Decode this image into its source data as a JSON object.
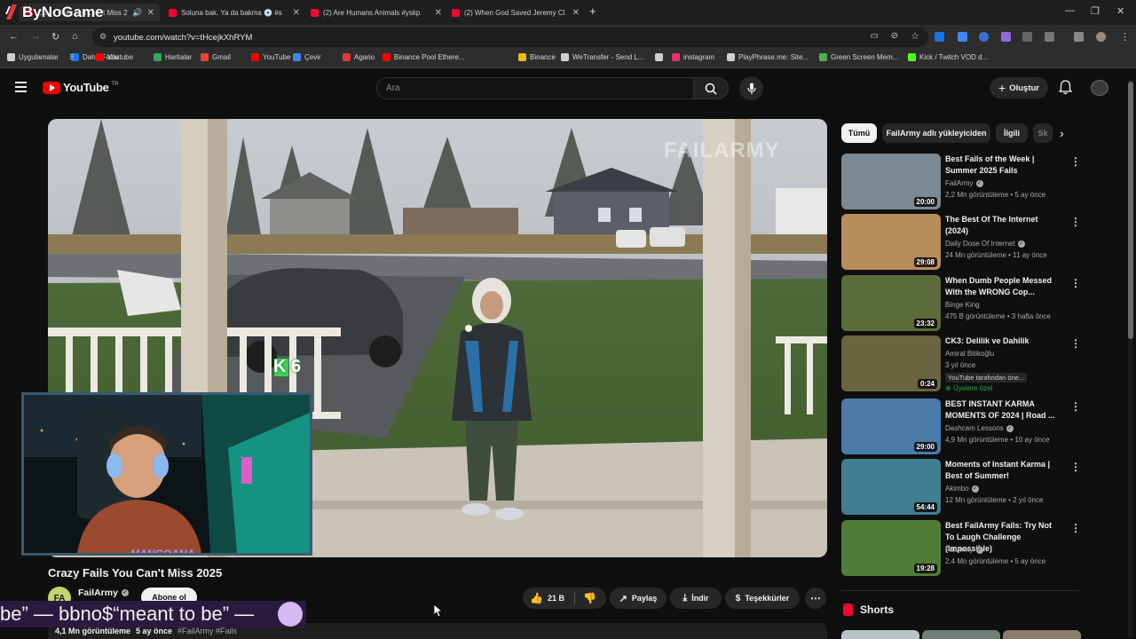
{
  "browser": {
    "tabs": [
      {
        "title": "Crazy Fails You Can't Miss 2025",
        "active": true
      },
      {
        "title": "Soluna bak. Ya da bakma 💿 #s"
      },
      {
        "title": "(2) Are Humans Animals #yskp"
      },
      {
        "title": "(2) When God Saved Jeremy Cl"
      }
    ],
    "new_tab": "+",
    "url": "youtube.com/watch?v=tHcejkXhRYM",
    "bookmarks": [
      {
        "label": "Uygulamalar",
        "color": "#d0d0d0"
      },
      {
        "label": "Daha Fazla",
        "color": "#1877f2"
      },
      {
        "label": "Youtube",
        "color": "#ff0000"
      },
      {
        "label": "Haritalar",
        "color": "#34a853"
      },
      {
        "label": "Gmail",
        "color": "#ea4335"
      },
      {
        "label": "YouTube",
        "color": "#ff0000"
      },
      {
        "label": "Çevir",
        "color": "#4285f4"
      },
      {
        "label": "Agario",
        "color": "#e53935"
      },
      {
        "label": "Binance Pool Ethere...",
        "color": "#ff0000"
      },
      {
        "label": "Binance",
        "color": "#f0b90b"
      },
      {
        "label": "WeTransfer - Send L...",
        "color": "#cfcfcf"
      },
      {
        "label": "",
        "color": "#cfcfcf"
      },
      {
        "label": "instagram",
        "color": "#e1306c"
      },
      {
        "label": "PlayPhrase.me: Site...",
        "color": "#cfcfcf"
      },
      {
        "label": "Green Screen Mem...",
        "color": "#4caf50"
      },
      {
        "label": "Kick / Twitch VOD d...",
        "color": "#53fc18"
      }
    ]
  },
  "overlay": {
    "stream_logo": "ByNoGame",
    "cam_label": "MANGOANA",
    "lyrics": "be” — bbno$“meant to be” —",
    "video_overlay_text": "K 6",
    "watermark": "FAILARMY"
  },
  "youtube": {
    "logo": "YouTube",
    "country": "TR",
    "search_placeholder": "Ara",
    "create_label": "Oluştur",
    "video": {
      "title": "Crazy Fails You Can't Miss 2025",
      "channel": "FailArmy",
      "channel_initials": "FA",
      "subscribe_label": "Abone ol",
      "likes": "21 B",
      "share_label": "Paylaş",
      "download_label": "İndir",
      "thanks_label": "Teşekkürler",
      "views": "4,1 Mn görüntüleme",
      "age": "5 ay önce",
      "hashtags": "#FailArmy #Fails"
    },
    "chips": [
      "Tümü",
      "FailArmy adlı yükleyiciden",
      "İlgili",
      "Sk"
    ],
    "recommendations": [
      {
        "title": "Best Fails of the Week | Summer 2025 Fails",
        "channel": "FailArmy",
        "verified": true,
        "meta": "2,2 Mn görüntüleme • 5 ay önce",
        "duration": "20:00",
        "thumb": "#7c8a95"
      },
      {
        "title": "The Best Of The Internet (2024)",
        "channel": "Daily Dose Of Internet",
        "verified": true,
        "meta": "24 Mn görüntüleme • 11 ay önce",
        "duration": "29:08",
        "thumb": "#b98d5a"
      },
      {
        "title": "When Dumb People Messed With the WRONG Cop...",
        "channel": "Binge King",
        "verified": false,
        "meta": "475 B görüntüleme • 3 hafta önce",
        "duration": "23:32",
        "thumb": "#5c6b3a"
      },
      {
        "title": "CK3: Delilik ve Dahilik",
        "channel": "Amiral Bitikoğlu",
        "verified": false,
        "meta": "3 yıl önce",
        "duration": "0:24",
        "thumb": "#6b6440",
        "tag": "YouTube tarafından öne...",
        "members": "Üyelere özel"
      },
      {
        "title": "BEST INSTANT KARMA MOMENTS OF 2024 | Road ...",
        "channel": "Dashcam Lessons",
        "verified": true,
        "meta": "4,9 Mn görüntüleme • 10 ay önce",
        "duration": "29:00",
        "thumb": "#4a7aa8"
      },
      {
        "title": "Moments of Instant Karma | Best of Summer!",
        "channel": "Akimbo",
        "verified": true,
        "meta": "12 Mn görüntüleme • 2 yıl önce",
        "duration": "54:44",
        "thumb": "#3f7f8f"
      },
      {
        "title": "Best FailArmy Fails: Try Not To Laugh Challenge (Impossible)",
        "channel": "FailArmy",
        "verified": true,
        "meta": "2,4 Mn görüntüleme • 5 ay önce",
        "duration": "19:28",
        "thumb": "#4f7d36"
      }
    ],
    "shorts_label": "Shorts"
  }
}
